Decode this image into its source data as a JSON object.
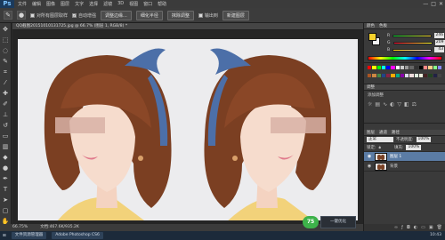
{
  "app": {
    "logo": "Ps",
    "menu": [
      "文件",
      "编辑",
      "图像",
      "图层",
      "文字",
      "选择",
      "滤镜",
      "3D",
      "视图",
      "窗口",
      "帮助"
    ],
    "window_controls": [
      "—",
      "□",
      "✕"
    ]
  },
  "options_bar": {
    "checkbox_1": "对所有图层取样",
    "checkbox_2": "自动增强",
    "btn_1": "调整边缘...",
    "btn_2": "细化半径",
    "btn_3": "抹除调整",
    "select_value": "",
    "checkbox_3": "输出到",
    "btn_4": "新建图层"
  },
  "document": {
    "tab_title": "QQ截图20151010131725.jpg @ 66.7% (图层 1, RGB/8) *"
  },
  "status": {
    "zoom": "66.75%",
    "doc_info": "文档:467.6K/935.2K"
  },
  "overlay": {
    "badge": "75",
    "button": "一键优化"
  },
  "taskbar": {
    "start": "⊞",
    "item_1": "文件资源管理器",
    "item_2": "Adobe Photoshop CS6",
    "clock": "10:43"
  },
  "panels": {
    "color_tab": "颜色",
    "swatches_tab": "色板",
    "adjust_tab": "调整",
    "adjust_title": "添加调整",
    "color_sliders": [
      {
        "label": "R",
        "value": "246"
      },
      {
        "label": "G",
        "value": "209"
      },
      {
        "label": "B",
        "value": "43"
      }
    ],
    "layers_tabs": [
      "图层",
      "通道",
      "路径"
    ],
    "blend_mode": "正常",
    "opacity_label": "不透明度:",
    "opacity_value": "100%",
    "lock_label": "锁定:",
    "fill_label": "填充:",
    "fill_value": "100%",
    "layers": [
      {
        "name": "图层 1",
        "active": true
      },
      {
        "name": "背景",
        "active": false
      }
    ]
  },
  "colors": {
    "foreground": "#f6d12b",
    "background": "#f2f2f2",
    "accent": "#5b7ca5"
  }
}
